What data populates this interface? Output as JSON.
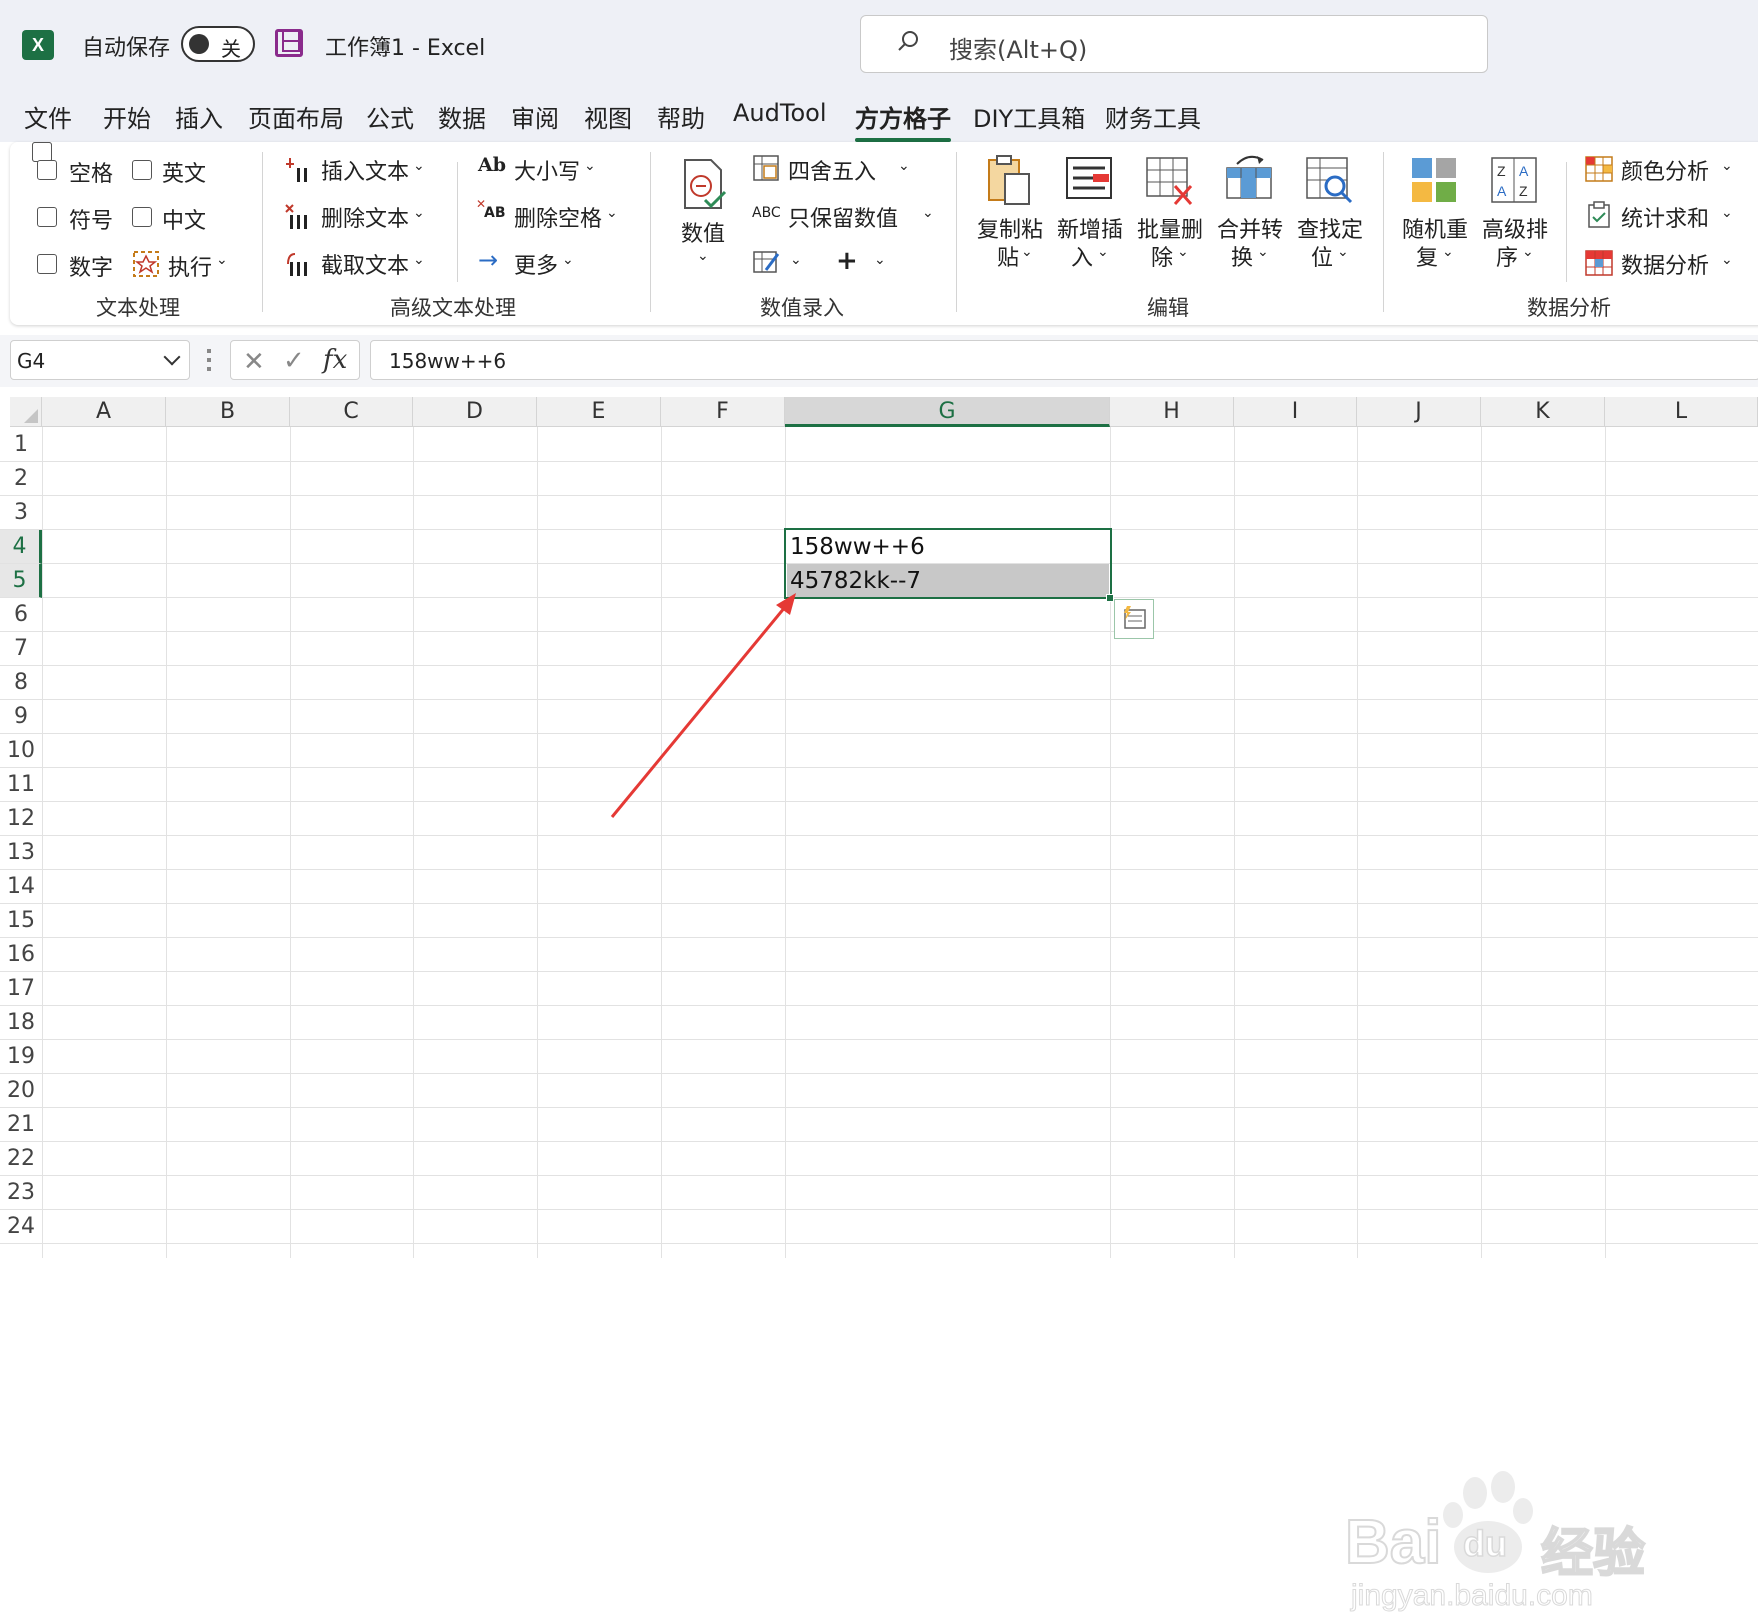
{
  "app": {
    "logo": "X",
    "autosave_label": "自动保存",
    "autosave_state": "关",
    "doc_title": "工作簿1  -  Excel",
    "search_placeholder": "搜索(Alt+Q)",
    "accent_color": "#1d7044"
  },
  "tabs": [
    "文件",
    "开始",
    "插入",
    "页面布局",
    "公式",
    "数据",
    "审阅",
    "视图",
    "帮助",
    "AudTool",
    "方方格子",
    "DIY工具箱",
    "财务工具"
  ],
  "active_tab": "方方格子",
  "ribbon": {
    "text_group": {
      "label": "文本处理",
      "checks": [
        "空格",
        "英文",
        "符号",
        "中文",
        "数字"
      ],
      "execute": "执行"
    },
    "adv_text_group": {
      "label": "高级文本处理",
      "insert_text": "插入文本",
      "delete_text": "删除文本",
      "cut_text": "截取文本",
      "case": "大小写",
      "delete_space": "删除空格",
      "more": "更多",
      "icon_text_ab": "Ab",
      "icon_text_xab": "AB"
    },
    "value_group": {
      "label": "数值录入",
      "value_btn": "数值",
      "round": "四舍五入",
      "keep_values": "只保留数值",
      "abc_icon": "ABC",
      "plus": "+"
    },
    "edit_group": {
      "label": "编辑",
      "copy_paste_1": "复制粘",
      "copy_paste_2": "贴",
      "new_insert_1": "新增插",
      "new_insert_2": "入",
      "batch_delete_1": "批量删",
      "batch_delete_2": "除",
      "merge_1": "合并转",
      "merge_2": "换",
      "find_1": "查找定",
      "find_2": "位"
    },
    "analysis_group": {
      "label": "数据分析",
      "random_1": "随机重",
      "random_2": "复",
      "sort_1": "高级排",
      "sort_2": "序",
      "color_analysis": "颜色分析",
      "sum_stats": "统计求和",
      "data_analysis": "数据分析"
    }
  },
  "formula_bar": {
    "name_box": "G4",
    "formula": "158ww++6"
  },
  "sheet": {
    "columns": [
      "A",
      "B",
      "C",
      "D",
      "E",
      "F",
      "G",
      "H",
      "I",
      "J",
      "K",
      "L"
    ],
    "selected_column": "G",
    "rows": [
      "1",
      "2",
      "3",
      "4",
      "5",
      "6",
      "7",
      "8",
      "9",
      "10",
      "11",
      "12",
      "13",
      "14",
      "15",
      "16",
      "17",
      "18",
      "19",
      "20",
      "21",
      "22",
      "23",
      "24"
    ],
    "selected_rows": [
      "4",
      "5"
    ],
    "cells": {
      "G4": "158ww++6",
      "G5": "45782kk--7"
    }
  },
  "watermark": {
    "brand": "Bai",
    "brand_du": "du",
    "brand_cn": "经验",
    "url": "jingyan.baidu.com"
  }
}
